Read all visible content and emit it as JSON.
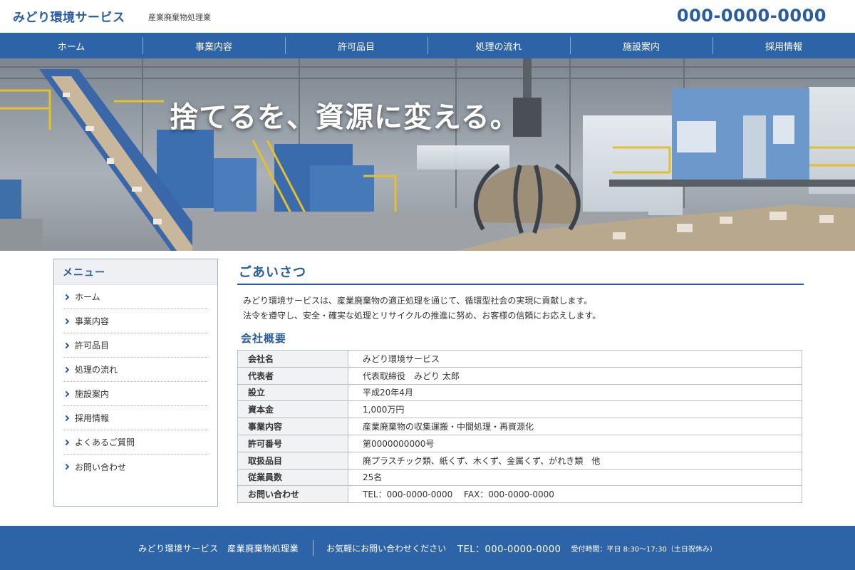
{
  "header": {
    "company_name": "みどり環境サービス",
    "subtitle": "産業廃棄物処理業",
    "phone": "000-0000-0000"
  },
  "nav": {
    "items": [
      {
        "label": "ホーム"
      },
      {
        "label": "事業内容"
      },
      {
        "label": "許可品目"
      },
      {
        "label": "処理の流れ"
      },
      {
        "label": "施設案内"
      },
      {
        "label": "採用情報"
      }
    ]
  },
  "hero": {
    "catchcopy": "捨てるを、資源に変える。"
  },
  "sidebar": {
    "title": "メニュー",
    "items": [
      {
        "label": "ホーム"
      },
      {
        "label": "事業内容"
      },
      {
        "label": "許可品目"
      },
      {
        "label": "処理の流れ"
      },
      {
        "label": "施設案内"
      },
      {
        "label": "採用情報"
      },
      {
        "label": "よくあるご質問"
      },
      {
        "label": "お問い合わせ"
      }
    ]
  },
  "main": {
    "greeting_title": "ごあいさつ",
    "greeting_lines": [
      "みどり環境サービスは、産業廃棄物の適正処理を通じて、循環型社会の実現に貢献します。",
      "法令を遵守し、安全・確実な処理とリサイクルの推進に努め、お客様の信頼にお応えします。"
    ],
    "company_title": "会社概要",
    "overview": [
      {
        "label": "会社名",
        "value": "みどり環境サービス"
      },
      {
        "label": "代表者",
        "value": "代表取締役　みどり 太郎"
      },
      {
        "label": "設立",
        "value": "平成20年4月"
      },
      {
        "label": "資本金",
        "value": "1,000万円"
      },
      {
        "label": "事業内容",
        "value": "産業廃棄物の収集運搬・中間処理・再資源化"
      },
      {
        "label": "許可番号",
        "value": "第0000000000号"
      },
      {
        "label": "取扱品目",
        "value": "廃プラスチック類、紙くず、木くず、金属くず、がれき類　他"
      },
      {
        "label": "従業員数",
        "value": "25名"
      },
      {
        "label": "お問い合わせ",
        "value": "TEL：000-0000-0000　 FAX：000-0000-0000"
      }
    ]
  },
  "footer": {
    "company": "みどり環境サービス　産業廃棄物処理業",
    "call": "お気軽にお問い合わせください",
    "tel": "TEL：000-0000-0000",
    "hours": "受付時間：平日 8:30〜17:30（土日祝休み）"
  },
  "colors": {
    "brand": "#2d64a8",
    "heading": "#2a5da0",
    "sidebar_border": "#9bb4d2"
  }
}
